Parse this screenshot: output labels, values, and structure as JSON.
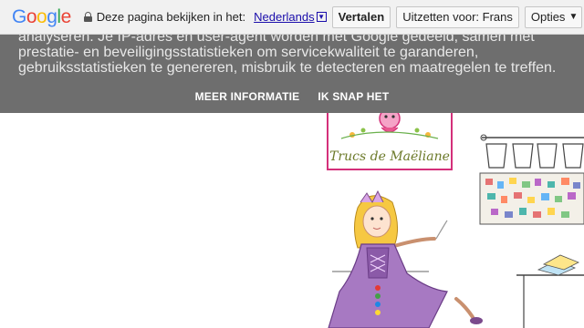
{
  "translate_bar": {
    "logo_letters": [
      "G",
      "o",
      "o",
      "g",
      "l",
      "e"
    ],
    "logo_colors": [
      "#4285f4",
      "#ea4335",
      "#fbbc05",
      "#4285f4",
      "#34a853",
      "#ea4335"
    ],
    "prompt": "Deze pagina bekijken in het:",
    "language": "Nederlands",
    "language_caret": "▼",
    "translate_label": "Vertalen",
    "turn_off_label": "Uitzetten voor: Frans",
    "options_label": "Opties",
    "options_caret": "▼"
  },
  "cookie_banner": {
    "text": "analyseren. Je IP-adres en user-agent worden met Google gedeeld, samen met prestatie- en beveiligingsstatistieken om servicekwaliteit te garanderen, gebruiksstatistieken te genereren, misbruik te detecteren en maatregelen te treffen.",
    "more_info": "MEER INFORMATIE",
    "accept": "IK SNAP HET",
    "background": "#6e6e6e"
  },
  "blog_logo": {
    "text": "Trucs de Maëliane",
    "border_color": "#d4307a"
  },
  "icons": [
    "lock-icon",
    "dropdown-caret-icon"
  ]
}
